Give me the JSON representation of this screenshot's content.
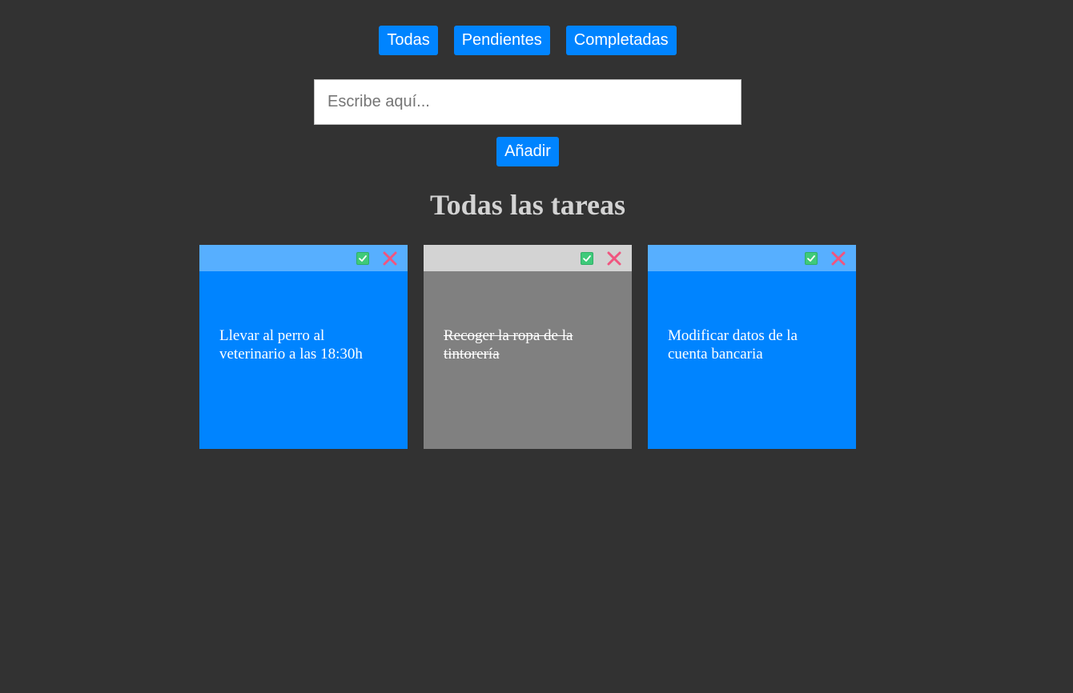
{
  "filters": {
    "all": "Todas",
    "pending": "Pendientes",
    "completed": "Completadas"
  },
  "input": {
    "placeholder": "Escribe aquí...",
    "value": ""
  },
  "add_label": "Añadir",
  "heading": "Todas las tareas",
  "tasks": [
    {
      "text": "Llevar al perro al veterinario a las 18:30h",
      "completed": false
    },
    {
      "text": "Recoger la ropa de la tintorería",
      "completed": true
    },
    {
      "text": "Modificar datos de la cuenta bancaria",
      "completed": false
    }
  ],
  "colors": {
    "background": "#323232",
    "accent": "#0084ff",
    "card_bar": "#57afff",
    "card_completed": "#808080",
    "card_completed_bar": "#d3d3d3",
    "check": "#3fca7a",
    "delete": "#f0557f"
  },
  "icons": {
    "complete": "check-box-icon",
    "delete": "close-icon"
  }
}
